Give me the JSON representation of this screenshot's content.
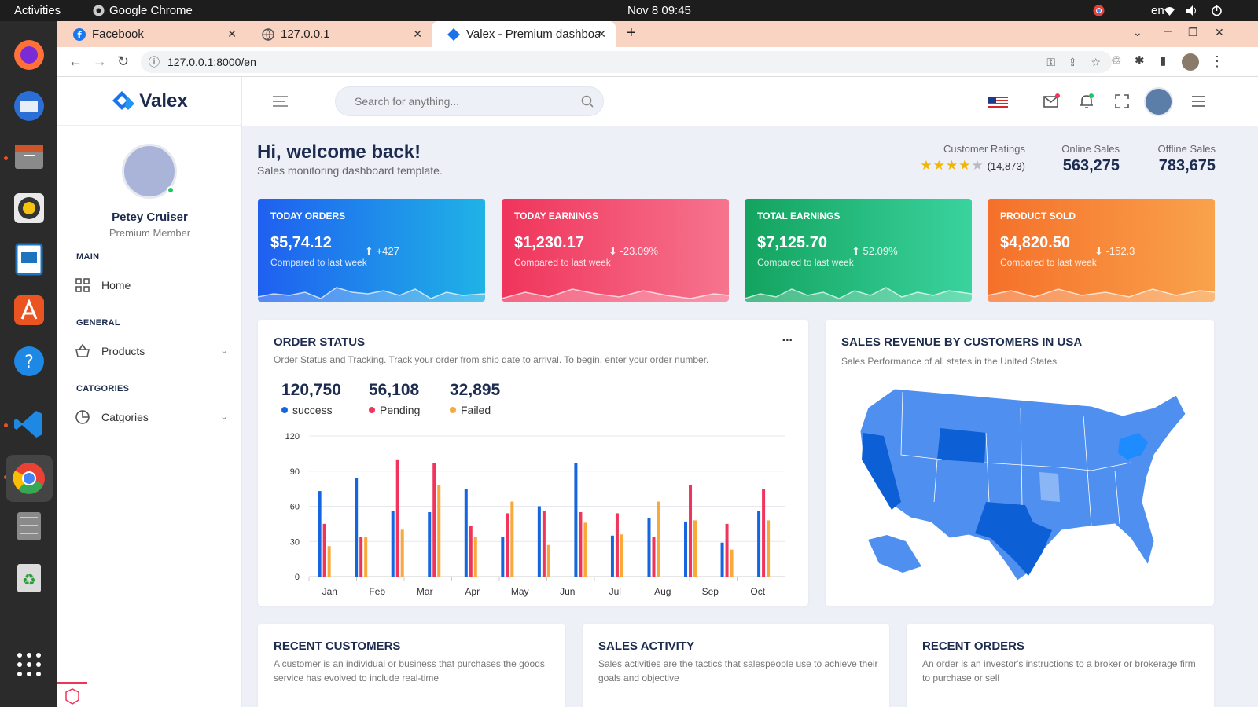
{
  "os": {
    "activities": "Activities",
    "app_name": "Google Chrome",
    "clock": "Nov 8  09:45",
    "lang": "en"
  },
  "browser": {
    "tabs": [
      {
        "label": "Facebook"
      },
      {
        "label": "127.0.0.1"
      },
      {
        "label": "Valex - Premium dashboa"
      }
    ],
    "url": "127.0.0.1:8000/en"
  },
  "app": {
    "brand": "Valex",
    "search_placeholder": "Search for anything...",
    "user": {
      "name": "Petey Cruiser",
      "role": "Premium Member"
    },
    "sidebar": {
      "sections": [
        {
          "title": "MAIN",
          "items": [
            {
              "label": "Home",
              "icon": "grid-icon"
            }
          ]
        },
        {
          "title": "GENERAL",
          "items": [
            {
              "label": "Products",
              "icon": "basket-icon"
            }
          ]
        },
        {
          "title": "CATGORIES",
          "items": [
            {
              "label": "Catgories",
              "icon": "pie-icon"
            }
          ]
        }
      ]
    },
    "welcome": {
      "title": "Hi, welcome back!",
      "subtitle": "Sales monitoring dashboard template."
    },
    "ratings": {
      "label": "Customer Ratings",
      "count": "(14,873)",
      "stars": 4
    },
    "online_sales": {
      "label": "Online Sales",
      "value": "563,275"
    },
    "offline_sales": {
      "label": "Offline Sales",
      "value": "783,675"
    },
    "kpis": [
      {
        "title": "TODAY ORDERS",
        "value": "$5,74.12",
        "compare": "Compared to last week",
        "delta": "+427",
        "dir": "up",
        "color1": "#1f5ff0",
        "color2": "#1fb3e6"
      },
      {
        "title": "TODAY EARNINGS",
        "value": "$1,230.17",
        "compare": "Compared to last week",
        "delta": "-23.09%",
        "dir": "down",
        "color1": "#f0345b",
        "color2": "#f6748e"
      },
      {
        "title": "TOTAL EARNINGS",
        "value": "$7,125.70",
        "compare": "Compared to last week",
        "delta": "52.09%",
        "dir": "up",
        "color1": "#13a35f",
        "color2": "#3ad39e"
      },
      {
        "title": "PRODUCT SOLD",
        "value": "$4,820.50",
        "compare": "Compared to last week",
        "delta": "-152.3",
        "dir": "down",
        "color1": "#f5702a",
        "color2": "#f9a24b"
      }
    ],
    "order_status": {
      "title": "ORDER STATUS",
      "subtitle": "Order Status and Tracking. Track your order from ship date to arrival. To begin, enter your order number.",
      "more": "...",
      "stats": [
        {
          "value": "120,750",
          "label": "success",
          "color": "#1565e0"
        },
        {
          "value": "56,108",
          "label": "Pending",
          "color": "#f0345b"
        },
        {
          "value": "32,895",
          "label": "Failed",
          "color": "#f8a93a"
        }
      ]
    },
    "usa_map": {
      "title": "SALES REVENUE BY CUSTOMERS IN USA",
      "subtitle": "Sales Performance of all states in the United States"
    },
    "bottom_cards": [
      {
        "title": "RECENT CUSTOMERS",
        "subtitle": "A customer is an individual or business that purchases the goods service has evolved to include real-time"
      },
      {
        "title": "SALES ACTIVITY",
        "subtitle": "Sales activities are the tactics that salespeople use to achieve their goals and objective"
      },
      {
        "title": "RECENT ORDERS",
        "subtitle": "An order is an investor's instructions to a broker or brokerage firm to purchase or sell"
      }
    ]
  },
  "chart_data": {
    "type": "bar",
    "categories": [
      "Jan",
      "Feb",
      "Mar",
      "Apr",
      "May",
      "Jun",
      "Jul",
      "Aug",
      "Sep",
      "Oct"
    ],
    "ylim": [
      0,
      120
    ],
    "yticks": [
      0,
      30,
      60,
      90,
      120
    ],
    "series": [
      {
        "name": "success",
        "color": "#1565e0",
        "values": [
          73,
          84,
          56,
          55,
          75,
          34,
          60,
          97,
          35,
          50,
          47,
          29,
          56
        ]
      },
      {
        "name": "Pending",
        "color": "#f0345b",
        "values": [
          45,
          34,
          100,
          97,
          43,
          54,
          56,
          55,
          54,
          34,
          78,
          45,
          75
        ]
      },
      {
        "name": "Failed",
        "color": "#f8a93a",
        "values": [
          26,
          34,
          40,
          78,
          34,
          64,
          27,
          46,
          36,
          64,
          48,
          23,
          48
        ]
      }
    ]
  }
}
